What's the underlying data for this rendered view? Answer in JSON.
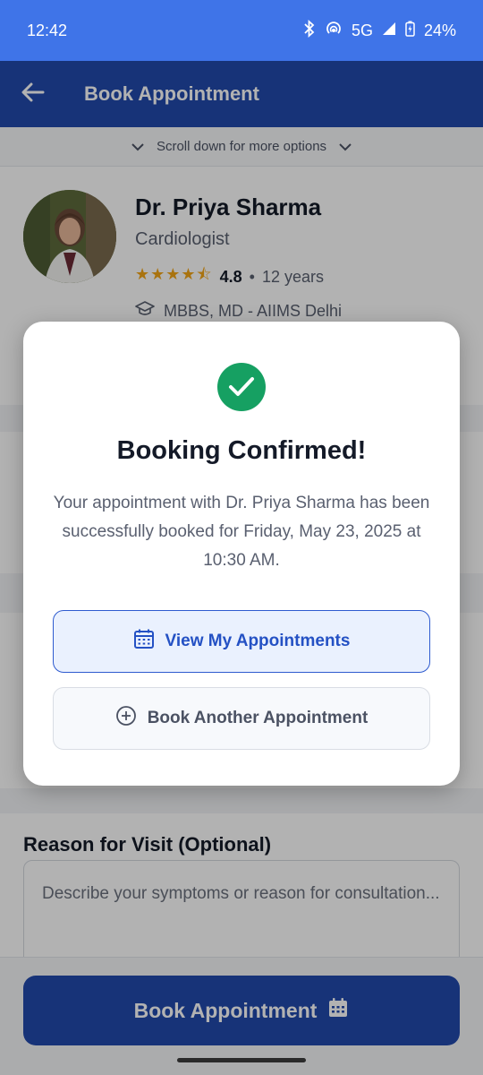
{
  "status_bar": {
    "time": "12:42",
    "network": "5G",
    "battery": "24%",
    "icons": [
      "bluetooth-icon",
      "hotspot-icon",
      "signal-icon",
      "battery-charging-icon"
    ]
  },
  "app_bar": {
    "title": "Book Appointment",
    "back_icon": "arrow-back-icon"
  },
  "hint": {
    "text": "Scroll down for more options"
  },
  "doctor": {
    "name": "Dr. Priya Sharma",
    "specialty": "Cardiologist",
    "rating": "4.8",
    "stars": "★★★★⯪",
    "separator": "•",
    "experience": "12 years",
    "education": "MBBS, MD - AIIMS Delhi"
  },
  "reason": {
    "title": "Reason for Visit (Optional)",
    "placeholder": "Describe your symptoms or reason for consultation..."
  },
  "bottom_button": {
    "label": "Book Appointment"
  },
  "modal": {
    "title": "Booking Confirmed!",
    "message": "Your appointment with Dr. Priya Sharma has been successfully booked for Friday, May 23, 2025 at 10:30 AM.",
    "primary_button": "View My Appointments",
    "secondary_button": "Book Another Appointment"
  },
  "colors": {
    "status_bar": "#3f74e8",
    "app_bar": "#2149ad",
    "success": "#16a062",
    "primary_text": "#2451c4",
    "star": "#f2a516"
  }
}
